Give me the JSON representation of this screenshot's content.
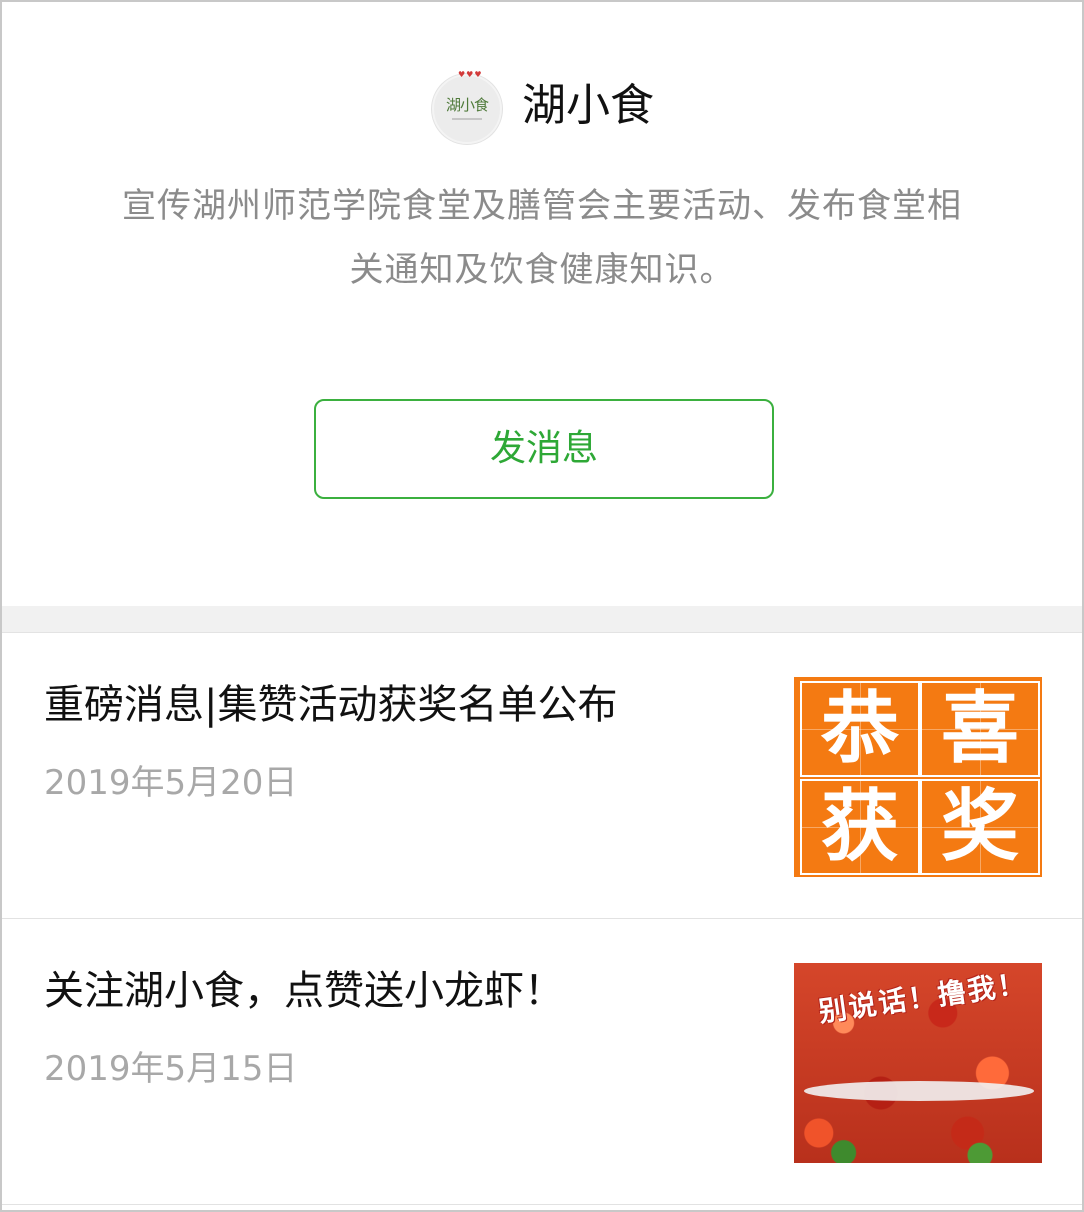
{
  "account": {
    "avatar_text": "湖小食",
    "name": "湖小食",
    "description_line1": "宣传湖州师范学院食堂及膳管会主要活动、发布食堂相",
    "description_line2": "关通知及饮食健康知识。",
    "message_button": "发消息"
  },
  "articles": [
    {
      "title": "重磅消息|集赞活动获奖名单公布",
      "date": "2019年5月20日",
      "thumb_chars": [
        "恭",
        "喜",
        "获",
        "奖"
      ]
    },
    {
      "title": "关注湖小食，点赞送小龙虾！",
      "date": "2019年5月15日",
      "thumb_text": "别说话！撸我！"
    }
  ],
  "colors": {
    "accent_green": "#2ea836",
    "congrats_orange": "#f47a12"
  }
}
